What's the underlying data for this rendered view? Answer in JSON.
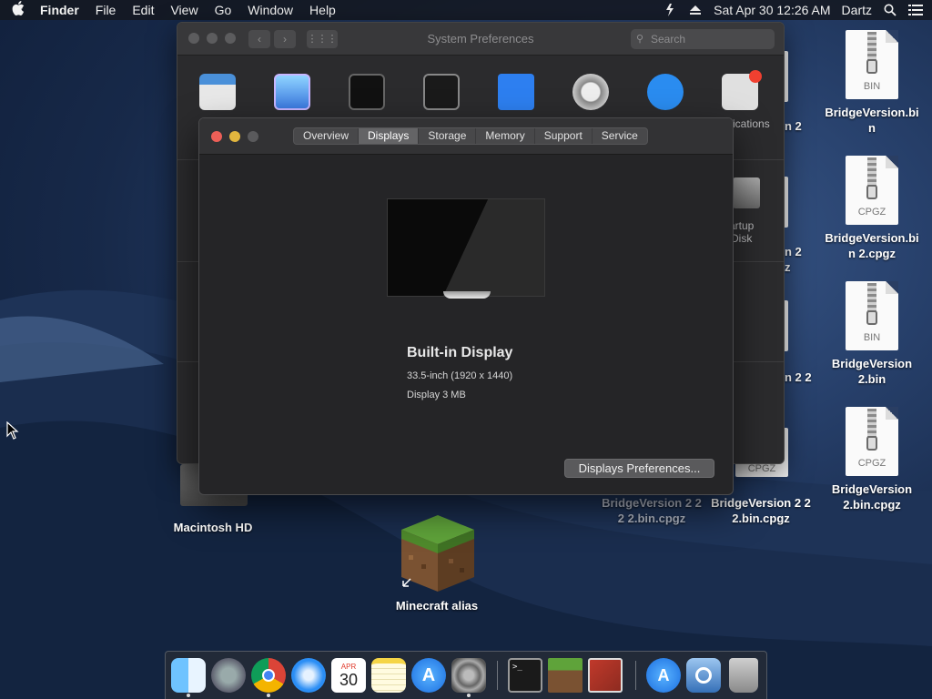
{
  "menubar": {
    "app": "Finder",
    "items": [
      "File",
      "Edit",
      "View",
      "Go",
      "Window",
      "Help"
    ],
    "clock": "Sat Apr 30  12:26 AM",
    "user": "Dartz",
    "icons": [
      "apple-icon",
      "script-icon",
      "eject-icon",
      "spotlight-icon",
      "control-center-icon"
    ]
  },
  "sysprefs": {
    "title": "System Preferences",
    "search_placeholder": "Search",
    "peek": {
      "applications": "ications",
      "startup_line1": "artup",
      "startup_line2": "Disk"
    }
  },
  "about": {
    "tabs": [
      "Overview",
      "Displays",
      "Storage",
      "Memory",
      "Support",
      "Service"
    ],
    "active_tab": "Displays",
    "display_name": "Built-in Display",
    "display_spec": "33.5-inch (1920 x 1440)",
    "display_memory": "Display 3 MB",
    "prefs_button": "Displays Preferences..."
  },
  "desktop": {
    "icons": [
      {
        "label_line1": "BridgeVersion.bi",
        "label_line2": "n",
        "ext": "BIN"
      },
      {
        "label_line1": "BridgeVersion.bi",
        "label_line2": "n 2.cpgz",
        "ext": "CPGZ"
      },
      {
        "label_line1": "BridgeVersion",
        "label_line2": "2.bin",
        "ext": "BIN"
      },
      {
        "label_line1": "BridgeVersion",
        "label_line2": "2.bin.cpgz",
        "ext": "CPGZ"
      }
    ],
    "peek_labels": {
      "n2a": "n 2",
      "n2b": "n 2",
      "z": "z",
      "n22": "n 2 2",
      "cpgz_ext": "CPGZ",
      "bv222_1": "BridgeVersion 2 2",
      "bv222_2": "2 2.bin.cpgz",
      "bv22_1": "BridgeVersion 2 2",
      "bv22_2": "2.bin.cpgz"
    },
    "hd_label": "Macintosh HD",
    "minecraft_label": "Minecraft alias"
  },
  "dock": {
    "items": [
      "finder-icon",
      "launchpad-icon",
      "chrome-icon",
      "safari-icon",
      "calendar-icon",
      "notes-icon",
      "app-store-icon",
      "system-preferences-icon",
      "terminal-icon",
      "minecraft-icon",
      "photo-booth-icon",
      "applications-folder-icon",
      "utility-icon",
      "trash-icon"
    ],
    "calendar": {
      "month": "APR",
      "day": "30"
    }
  }
}
